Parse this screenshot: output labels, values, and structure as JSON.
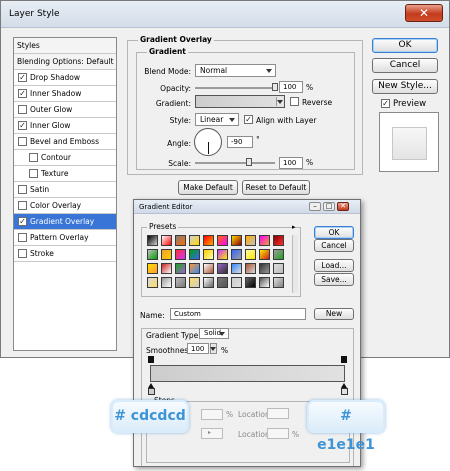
{
  "window": {
    "title": "Layer Style",
    "close_glyph": "✕"
  },
  "sidebar": {
    "items": [
      {
        "label": "Styles",
        "checkbox": false,
        "checked": false,
        "selected": false,
        "header": true
      },
      {
        "label": "Blending Options: Default",
        "checkbox": false,
        "checked": false,
        "selected": false,
        "header": true
      },
      {
        "label": "Drop Shadow",
        "checkbox": true,
        "checked": true,
        "selected": false
      },
      {
        "label": "Inner Shadow",
        "checkbox": true,
        "checked": true,
        "selected": false
      },
      {
        "label": "Outer Glow",
        "checkbox": true,
        "checked": false,
        "selected": false
      },
      {
        "label": "Inner Glow",
        "checkbox": true,
        "checked": true,
        "selected": false
      },
      {
        "label": "Bevel and Emboss",
        "checkbox": true,
        "checked": false,
        "selected": false
      },
      {
        "label": "Contour",
        "checkbox": true,
        "checked": false,
        "selected": false,
        "sub": true
      },
      {
        "label": "Texture",
        "checkbox": true,
        "checked": false,
        "selected": false,
        "sub": true
      },
      {
        "label": "Satin",
        "checkbox": true,
        "checked": false,
        "selected": false
      },
      {
        "label": "Color Overlay",
        "checkbox": true,
        "checked": false,
        "selected": false
      },
      {
        "label": "Gradient Overlay",
        "checkbox": true,
        "checked": true,
        "selected": true
      },
      {
        "label": "Pattern Overlay",
        "checkbox": true,
        "checked": false,
        "selected": false
      },
      {
        "label": "Stroke",
        "checkbox": true,
        "checked": false,
        "selected": false
      }
    ]
  },
  "panel": {
    "section_title": "Gradient Overlay",
    "group_title": "Gradient",
    "blend_mode_label": "Blend Mode:",
    "blend_mode_value": "Normal",
    "opacity_label": "Opacity:",
    "opacity_value": "100",
    "opacity_unit": "%",
    "opacity_fraction": 1.0,
    "gradient_label": "Gradient:",
    "reverse_label": "Reverse",
    "reverse_checked": false,
    "style_label": "Style:",
    "style_value": "Linear",
    "align_label": "Align with Layer",
    "align_checked": true,
    "angle_label": "Angle:",
    "angle_value": "-90",
    "angle_unit": "°",
    "scale_label": "Scale:",
    "scale_value": "100",
    "scale_unit": "%",
    "scale_fraction": 0.67,
    "make_default": "Make Default",
    "reset_default": "Reset to Default"
  },
  "right": {
    "ok": "OK",
    "cancel": "Cancel",
    "new_style": "New Style...",
    "preview_label": "Preview",
    "preview_checked": true
  },
  "gradient_editor": {
    "title": "Gradient Editor",
    "presets_label": "Presets",
    "ok": "OK",
    "cancel": "Cancel",
    "load": "Load...",
    "save": "Save...",
    "name_label": "Name:",
    "name_value": "Custom",
    "new_button": "New",
    "gradient_type_label": "Gradient Type:",
    "gradient_type_value": "Solid",
    "smoothness_label": "Smoothness:",
    "smoothness_value": "100",
    "smoothness_unit": "%",
    "stops_label": "Stops",
    "opacity_unit": "%",
    "location_label": "Location:",
    "location_unit": "%",
    "start_color": "#cdcdcd",
    "end_color": "#e1e1e1",
    "swatches": [
      "#000000",
      "#ffffff",
      "#808080",
      "#d0d0d0",
      "#ff0000",
      "#ff6a00",
      "#ffd700",
      "#ffaa00",
      "#ff00ff",
      "#8b0000",
      "#c0c0c0",
      "#f0a030",
      "#ff3030",
      "#00a000",
      "#ffcc00",
      "#cc33ff",
      "#3366ff",
      "#ffffaa",
      "#ffea00",
      "#9d9d9d",
      "#ffe000",
      "#cc2020",
      "#20a020",
      "#ff9933",
      "#ffffff",
      "#9966cc",
      "#3388ff",
      "#aa5533",
      "#333333",
      "#dddddd",
      "#d8d8d8",
      "#999999",
      "#bbbbbb",
      "#ffdd66",
      "#ffffff",
      "#777777",
      "#cccccc",
      "#666666",
      "#555555",
      "#e0e0e0"
    ]
  },
  "callouts": {
    "left": "# cdcdcd",
    "right": "# e1e1e1"
  }
}
